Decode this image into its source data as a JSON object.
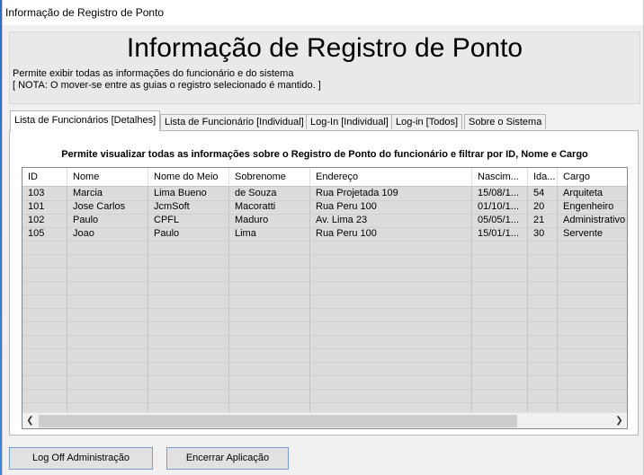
{
  "window": {
    "title": "Informação de Registro de Ponto"
  },
  "header": {
    "title": "Informação de Registro de Ponto",
    "description_line1": "Permite exibir todas as informações do funcionário e do sistema",
    "description_line2": "[ NOTA: O mover-se entre as guias o registro selecionado é mantido. ]"
  },
  "tabs": [
    {
      "label": "Lista de Funcionários [Detalhes]",
      "active": true
    },
    {
      "label": "Lista de Funcionário [Individual]",
      "active": false
    },
    {
      "label": "Log-In [Individual]",
      "active": false
    },
    {
      "label": "Log-in [Todos]",
      "active": false
    },
    {
      "label": "Sobre o Sistema",
      "active": false
    }
  ],
  "panel": {
    "subtitle": "Permite visualizar todas as informações sobre o Registro de Ponto do funcionário e filtrar por ID, Nome e Cargo"
  },
  "grid": {
    "columns": [
      "ID",
      "Nome",
      "Nome do Meio",
      "Sobrenome",
      "Endereço",
      "Nascim...",
      "Ida...",
      "Cargo"
    ],
    "rows": [
      [
        "103",
        "Marcia",
        "Lima Bueno",
        "de Souza",
        "Rua Projetada 109",
        "15/08/1...",
        "54",
        "Arquiteta"
      ],
      [
        "101",
        "Jose Carlos",
        "JcmSoft",
        "Macoratti",
        "Rua Peru 100",
        "01/10/1...",
        "20",
        "Engenheiro"
      ],
      [
        "102",
        "Paulo",
        "CPFL",
        "Maduro",
        "Av. Lima 23",
        "05/05/1...",
        "21",
        "Administrativo"
      ],
      [
        "105",
        "Joao",
        "Paulo",
        "Lima",
        "Rua Peru 100",
        "15/01/1...",
        "30",
        "Servente"
      ]
    ]
  },
  "scrollbar": {
    "left_icon": "chevron-left-icon",
    "right_icon": "chevron-right-icon"
  },
  "buttons": {
    "logoff": "Log Off Administração",
    "exit": "Encerrar Aplicação"
  }
}
